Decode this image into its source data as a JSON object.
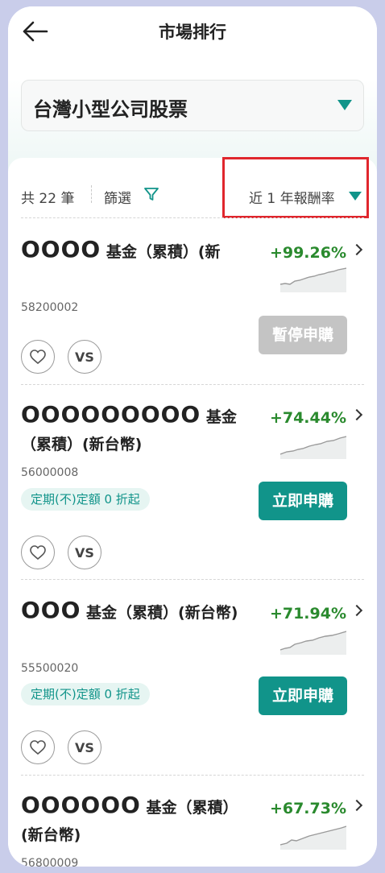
{
  "header": {
    "title": "市場排行"
  },
  "selector": {
    "value": "台灣小型公司股票"
  },
  "filterbar": {
    "count": "共 22 筆",
    "filter_label": "篩選",
    "sort_label": "近 1 年報酬率"
  },
  "colors": {
    "accent": "#11948a",
    "positive": "#2a8a2e",
    "disabled": "#c4c4c4",
    "highlight": "#e0262d"
  },
  "funds": [
    {
      "name_mask": "OOOO",
      "name_rest": "基金（累積）(新",
      "code": "58200002",
      "return": "+99.26%",
      "tag": "",
      "action": "暫停申購"
    },
    {
      "name_mask": "OOOOOOOOO",
      "name_rest": "基金（累積）(新台幣)",
      "code": "56000008",
      "return": "+74.44%",
      "tag": "定期(不)定額 0 折起",
      "action": "立即申購"
    },
    {
      "name_mask": "OOO",
      "name_rest": "基金（累積）(新台幣)",
      "code": "55500020",
      "return": "+71.94%",
      "tag": "定期(不)定額 0 折起",
      "action": "立即申購"
    },
    {
      "name_mask": "OOOOOO",
      "name_rest": "基金（累積）(新台幣)",
      "code": "56800009",
      "return": "+67.73%",
      "tag": "",
      "action": ""
    }
  ],
  "icons": {
    "back": "back-arrow-icon",
    "caret": "caret-down-icon",
    "filter": "filter-funnel-icon",
    "heart": "heart-icon",
    "chevron": "chevron-right-icon"
  },
  "compare_label": "VS"
}
